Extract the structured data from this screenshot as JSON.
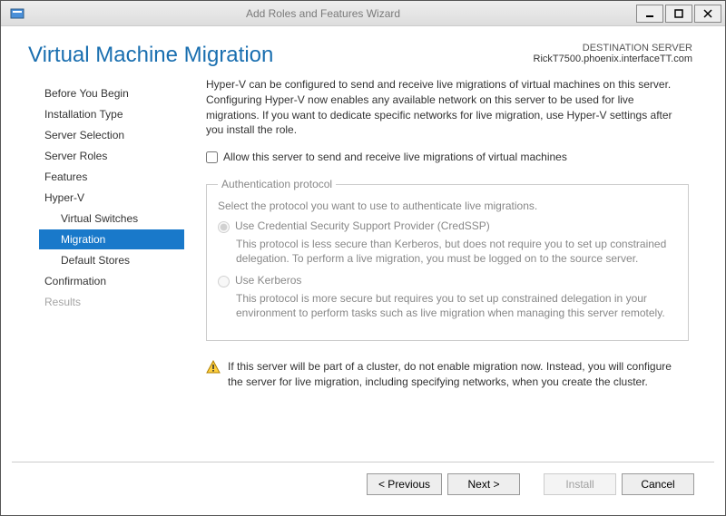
{
  "window": {
    "title": "Add Roles and Features Wizard"
  },
  "header": {
    "page_title": "Virtual Machine Migration",
    "dest_label": "DESTINATION SERVER",
    "dest_value": "RickT7500.phoenix.interfaceTT.com"
  },
  "sidebar": {
    "items": [
      {
        "label": "Before You Begin",
        "sub": false,
        "selected": false,
        "disabled": false
      },
      {
        "label": "Installation Type",
        "sub": false,
        "selected": false,
        "disabled": false
      },
      {
        "label": "Server Selection",
        "sub": false,
        "selected": false,
        "disabled": false
      },
      {
        "label": "Server Roles",
        "sub": false,
        "selected": false,
        "disabled": false
      },
      {
        "label": "Features",
        "sub": false,
        "selected": false,
        "disabled": false
      },
      {
        "label": "Hyper-V",
        "sub": false,
        "selected": false,
        "disabled": false
      },
      {
        "label": "Virtual Switches",
        "sub": true,
        "selected": false,
        "disabled": false
      },
      {
        "label": "Migration",
        "sub": true,
        "selected": true,
        "disabled": false
      },
      {
        "label": "Default Stores",
        "sub": true,
        "selected": false,
        "disabled": false
      },
      {
        "label": "Confirmation",
        "sub": false,
        "selected": false,
        "disabled": false
      },
      {
        "label": "Results",
        "sub": false,
        "selected": false,
        "disabled": true
      }
    ]
  },
  "main": {
    "description": "Hyper-V can be configured to send and receive live migrations of virtual machines on this server. Configuring Hyper-V now enables any available network on this server to be used for live migrations. If you want to dedicate specific networks for live migration, use Hyper-V settings after you install the role.",
    "allow_checkbox_label": "Allow this server to send and receive live migrations of virtual machines",
    "allow_checkbox_checked": false,
    "auth": {
      "legend": "Authentication protocol",
      "desc": "Select the protocol you want to use to authenticate live migrations.",
      "options": [
        {
          "label": "Use Credential Security Support Provider (CredSSP)",
          "sub": "This protocol is less secure than Kerberos, but does not require you to set up constrained delegation. To perform a live migration, you must be logged on to the source server.",
          "checked": true
        },
        {
          "label": "Use Kerberos",
          "sub": "This protocol is more secure but requires you to set up constrained delegation in your environment to perform tasks such as live migration when managing this server remotely.",
          "checked": false
        }
      ]
    },
    "warning": "If this server will be part of a cluster, do not enable migration now. Instead, you will configure the server for live migration, including specifying networks, when you create the cluster."
  },
  "footer": {
    "previous": "< Previous",
    "next": "Next >",
    "install": "Install",
    "cancel": "Cancel"
  }
}
